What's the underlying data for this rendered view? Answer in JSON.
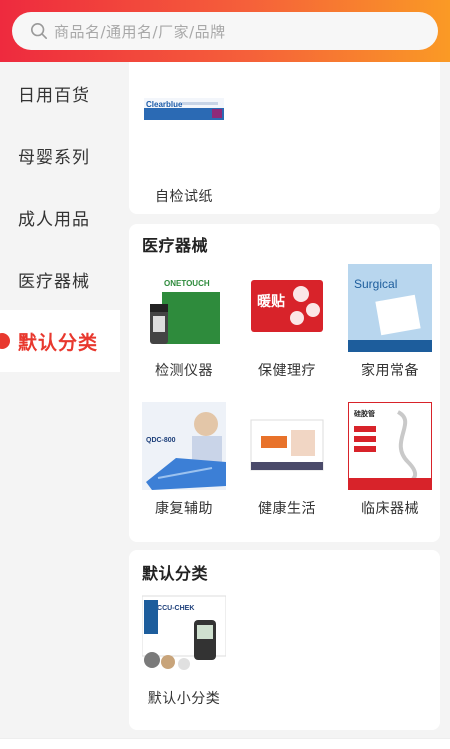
{
  "search": {
    "placeholder": "商品名/通用名/厂家/品牌"
  },
  "sidebar": {
    "items": [
      {
        "label": "日用百货"
      },
      {
        "label": "母婴系列"
      },
      {
        "label": "成人用品"
      },
      {
        "label": "医疗器械"
      },
      {
        "label": "默认分类",
        "active": true
      }
    ]
  },
  "content": {
    "section_top": {
      "items": [
        {
          "label": "自检试纸",
          "image_text": "Clearblue"
        }
      ]
    },
    "section_medical": {
      "title": "医疗器械",
      "items": [
        {
          "label": "检测仪器",
          "image_text": "ONETOUCH"
        },
        {
          "label": "保健理疗",
          "image_text": "暖贴"
        },
        {
          "label": "家用常备",
          "image_text": "Surgical"
        },
        {
          "label": "康复辅助",
          "image_text": "QDC-800"
        },
        {
          "label": "健康生活",
          "image_text": ""
        },
        {
          "label": "临床器械",
          "image_text": "硅胶管"
        }
      ]
    },
    "section_default": {
      "title": "默认分类",
      "items": [
        {
          "label": "默认小分类",
          "image_text": "ACCU-CHEK"
        }
      ]
    }
  },
  "colors": {
    "accent": "#e8382e",
    "header_start": "#ee2a3e",
    "header_end": "#fa9a25"
  }
}
